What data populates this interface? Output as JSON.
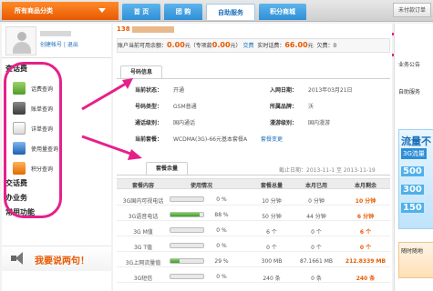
{
  "topnav": {
    "category_label": "所有商品分类",
    "tabs": [
      "首 页",
      "团 购",
      "自助服务",
      "积分商城"
    ],
    "right_button": "未付款订单"
  },
  "sidebar": {
    "username": "",
    "profile_links": "创建帐号 | 退出",
    "sections": [
      {
        "title": "查话费",
        "items": [
          "话费查询",
          "账单查询",
          "详单查询",
          "使用量查询",
          "积分查询"
        ]
      },
      {
        "title": "交话费",
        "items": []
      },
      {
        "title": "办业务",
        "items": []
      },
      {
        "title": "常用功能",
        "items": []
      }
    ],
    "banner_text": "我要说两句！"
  },
  "main": {
    "balance": {
      "label_available": "账户当前可用余额：",
      "available": "0.00",
      "unit": "元",
      "label_deposit": "（专项款",
      "deposit": "0.00",
      "deposit_suffix": "元）",
      "pay_link": "交费",
      "label_realtime": "实时话费：",
      "realtime": "66.00",
      "owe_label": "欠费：",
      "owe_value": "0"
    },
    "uid_prefix": "138",
    "number_info": {
      "tab": "号码信息",
      "rows": [
        {
          "l1": "当前状态：",
          "v1": "开通",
          "l2": "入网日期：",
          "v2": "2013年03月21日"
        },
        {
          "l1": "号码类型：",
          "v1": "GSM普通",
          "l2": "所属品牌：",
          "v2": "沃"
        },
        {
          "l1": "通话级别：",
          "v1": "国内通话",
          "l2": "漫游级别：",
          "v2": "国内漫游"
        },
        {
          "l1": "当前套餐：",
          "v1": "WCDMA(3G)-66元基本套餐A",
          "l2": "",
          "v2": "套餐变更"
        }
      ]
    },
    "usage": {
      "tab": "套餐余量",
      "period": "截止日期：2013-11-1 至 2013-11-19",
      "columns": [
        "套餐内容",
        "使用情况",
        "",
        "套餐总量",
        "本月已用",
        "本月剩余"
      ],
      "rows": [
        {
          "name": "3G国内可视电话",
          "pct": 0,
          "pct_text": "0 %",
          "total": "10 分钟",
          "used": "0 分钟",
          "remain": "10 分钟"
        },
        {
          "name": "3G语音电话",
          "pct": 88,
          "pct_text": "88 %",
          "total": "50 分钟",
          "used": "44 分钟",
          "remain": "6 分钟"
        },
        {
          "name": "3G M值",
          "pct": 0,
          "pct_text": "0 %",
          "total": "6 个",
          "used": "0 个",
          "remain": "6 个"
        },
        {
          "name": "3G T值",
          "pct": 0,
          "pct_text": "0 %",
          "total": "0 个",
          "used": "0 个",
          "remain": "0 个"
        },
        {
          "name": "3G上网流量值",
          "pct": 29,
          "pct_text": "29 %",
          "total": "300 MB",
          "used": "87.1661 MB",
          "remain": "212.8339 MB"
        },
        {
          "name": "3G短信",
          "pct": 0,
          "pct_text": "0 %",
          "total": "240 条",
          "used": "0 条",
          "remain": "240 条"
        }
      ]
    }
  },
  "right": {
    "t1": "业务公告",
    "t2": "自助服务",
    "promo_title": "流量不",
    "promo_sub": "3G流量",
    "promo_amounts": [
      "500",
      "300",
      "150"
    ],
    "bottom_title": "随时随地"
  }
}
